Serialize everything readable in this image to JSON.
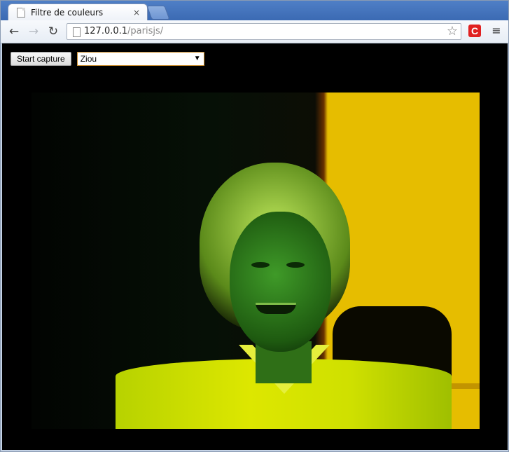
{
  "window": {
    "tab_title": "Filtre de couleurs",
    "tab_close_glyph": "×",
    "nav": {
      "back_icon": "back-arrow-icon",
      "forward_icon": "forward-arrow-icon",
      "reload_icon": "reload-icon"
    },
    "url": {
      "host": "127.0.0.1",
      "path": "/parisjs/"
    },
    "star_icon": "bookmark-star-icon",
    "extension_icon": "extension-c-icon",
    "extension_label": "C",
    "menu_icon": "wrench-menu-icon"
  },
  "page": {
    "capture_button_label": "Start capture",
    "filter_select_value": "Ziou",
    "filter_select_arrow": "▼",
    "video_feed": "webcam-filtered-frame"
  },
  "colors": {
    "tab_strip": "#3b6ab3",
    "content_bg": "#000000",
    "video_yellow": "#e6bd00",
    "video_green": "#bde65a",
    "extension_red": "#e02121"
  }
}
